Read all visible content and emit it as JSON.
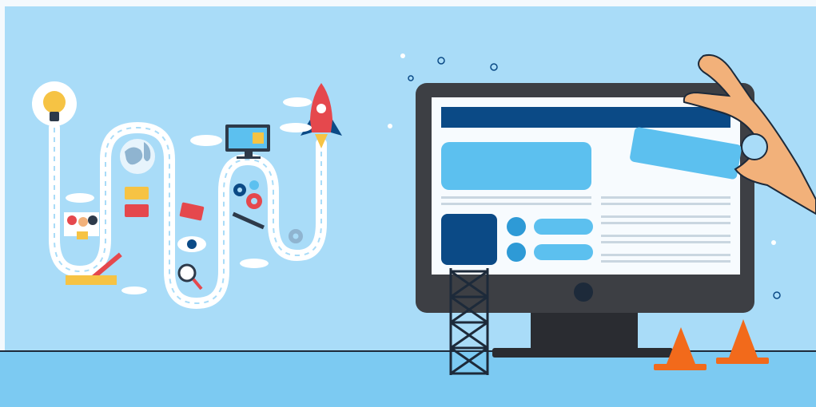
{
  "scene": {
    "colors": {
      "sky": "#a9dcf8",
      "floor": "#7ccaf2",
      "path": "#ffffff",
      "monitor_dark": "#3d3f44",
      "screen_blue": "#0b4a86",
      "panel_light": "#5cc0ef",
      "cone": "#f26a1b",
      "hand": "#f2b17a",
      "rocket": "#e5484d"
    },
    "icons": [
      "lightbulb-icon",
      "globe-icon",
      "people-icon",
      "chat-bubble-icon",
      "computer-icon",
      "gear-icon",
      "eye-icon",
      "magnifier-icon",
      "pencil-icon",
      "ruler-icon",
      "rocket-icon",
      "cloud-icon",
      "traffic-cone-icon",
      "scaffold-icon",
      "hand-icon"
    ]
  }
}
